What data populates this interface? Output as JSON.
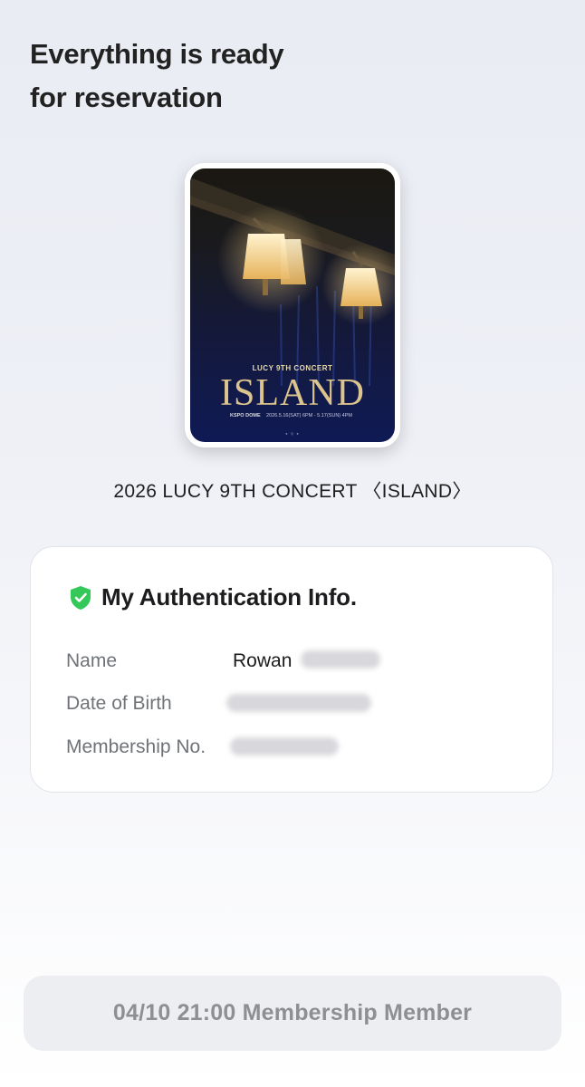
{
  "heading": {
    "line1": "Everything is ready",
    "line2": "for reservation"
  },
  "poster": {
    "subtitle": "LUCY 9TH CONCERT",
    "title": "ISLAND",
    "venue": "KSPO DOME",
    "dates": "2026.5.16(SAT) 6PM - 5.17(SUN) 4PM"
  },
  "event_title": "2026 LUCY 9TH CONCERT 〈ISLAND〉",
  "auth_card": {
    "title": "My Authentication Info.",
    "icon": "shield-check-icon",
    "accent_color": "#34c759",
    "rows": [
      {
        "label": "Name",
        "value": "Rowan"
      },
      {
        "label": "Date of Birth",
        "value": ""
      },
      {
        "label": "Membership No.",
        "value": ""
      }
    ]
  },
  "bottom_button": {
    "label": "04/10 21:00 Membership Member"
  }
}
